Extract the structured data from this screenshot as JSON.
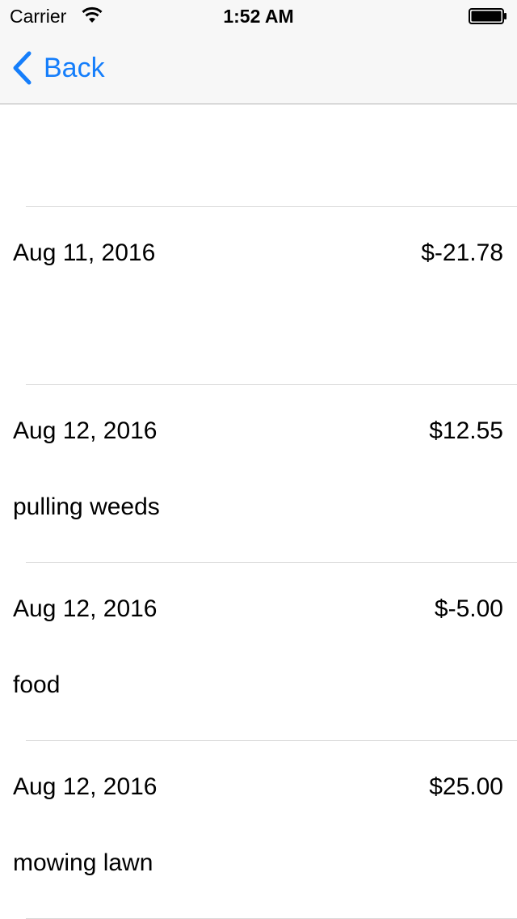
{
  "status_bar": {
    "carrier": "Carrier",
    "time": "1:52 AM",
    "icons": [
      "wifi-icon",
      "battery-icon"
    ]
  },
  "nav": {
    "back_label": "Back",
    "back_icon": "chevron-left-icon",
    "accent_color": "#157efb"
  },
  "transactions": [
    {
      "date": "Aug 11, 2016",
      "amount": "$-21.78",
      "note": ""
    },
    {
      "date": "Aug 12, 2016",
      "amount": "$12.55",
      "note": "pulling weeds"
    },
    {
      "date": "Aug 12, 2016",
      "amount": "$-5.00",
      "note": "food"
    },
    {
      "date": "Aug 12, 2016",
      "amount": "$25.00",
      "note": "mowing lawn"
    }
  ]
}
